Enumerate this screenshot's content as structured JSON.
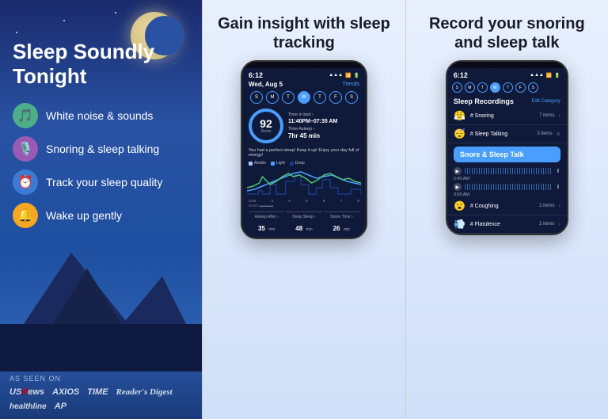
{
  "panel1": {
    "title": "Sleep Soundly Tonight",
    "features": [
      {
        "icon": "🎵",
        "text": "White noise & sounds",
        "colorClass": "icon-green"
      },
      {
        "icon": "🎙️",
        "text": "Snoring & sleep talking",
        "colorClass": "icon-purple"
      },
      {
        "icon": "⏰",
        "text": "Track your sleep quality",
        "colorClass": "icon-blue"
      },
      {
        "icon": "🔔",
        "text": "Wake up gently",
        "colorClass": "icon-orange"
      }
    ],
    "as_seen_on": "AS SEEN ON",
    "press": [
      "USNews",
      "AXIOS",
      "TIME",
      "Reader's Digest",
      "healthline",
      "AP"
    ]
  },
  "panel2": {
    "title": "Gain insight with sleep tracking",
    "phone": {
      "time": "6:12",
      "date": "Wed, Aug 5",
      "trends": "Trends",
      "days": [
        "S",
        "M",
        "T",
        "W",
        "T",
        "F",
        "S"
      ],
      "active_day": "W",
      "score": "92",
      "score_label": "Score",
      "time_in_bed_label": "Time in bed ›",
      "time_in_bed": "11:40PM–07:35 AM",
      "time_asleep_label": "Time Asleep ›",
      "time_asleep": "7hr 45 min",
      "message": "You had a perfect sleep! Keep it up! Enjoy your day full of energy!",
      "chart_times": [
        "2AM",
        "3",
        "4",
        "5",
        "6",
        "7",
        "8"
      ],
      "stats": [
        {
          "label": "Asleep After ›",
          "value": "35",
          "unit": "min"
        },
        {
          "label": "Deep Sleep ›",
          "value": "48",
          "unit": "min"
        },
        {
          "label": "Snore Time ›",
          "value": "26",
          "unit": "min"
        }
      ]
    }
  },
  "panel3": {
    "title": "Record your snoring and sleep talk",
    "phone": {
      "time": "6:12",
      "days": [
        "S",
        "M",
        "T",
        "W",
        "T",
        "F",
        "S"
      ],
      "active_day": "W",
      "recordings_title": "Sleep Recordings",
      "edit_category": "Edit Category",
      "tooltip": "Snore & Sleep Talk",
      "recordings": [
        {
          "emoji": "😤",
          "name": "# Snoring",
          "count": "7 items",
          "expanded": false
        },
        {
          "emoji": "😴",
          "name": "# Sleep Talking",
          "count": "3 items",
          "expanded": true
        },
        {
          "emoji": "😮",
          "name": "# Coughing",
          "count": "2 items",
          "expanded": false
        },
        {
          "emoji": "💨",
          "name": "# Flatulence",
          "count": "2 items",
          "expanded": false
        }
      ],
      "audio_times": [
        "2:45 AM",
        "3:50 AM"
      ]
    }
  }
}
